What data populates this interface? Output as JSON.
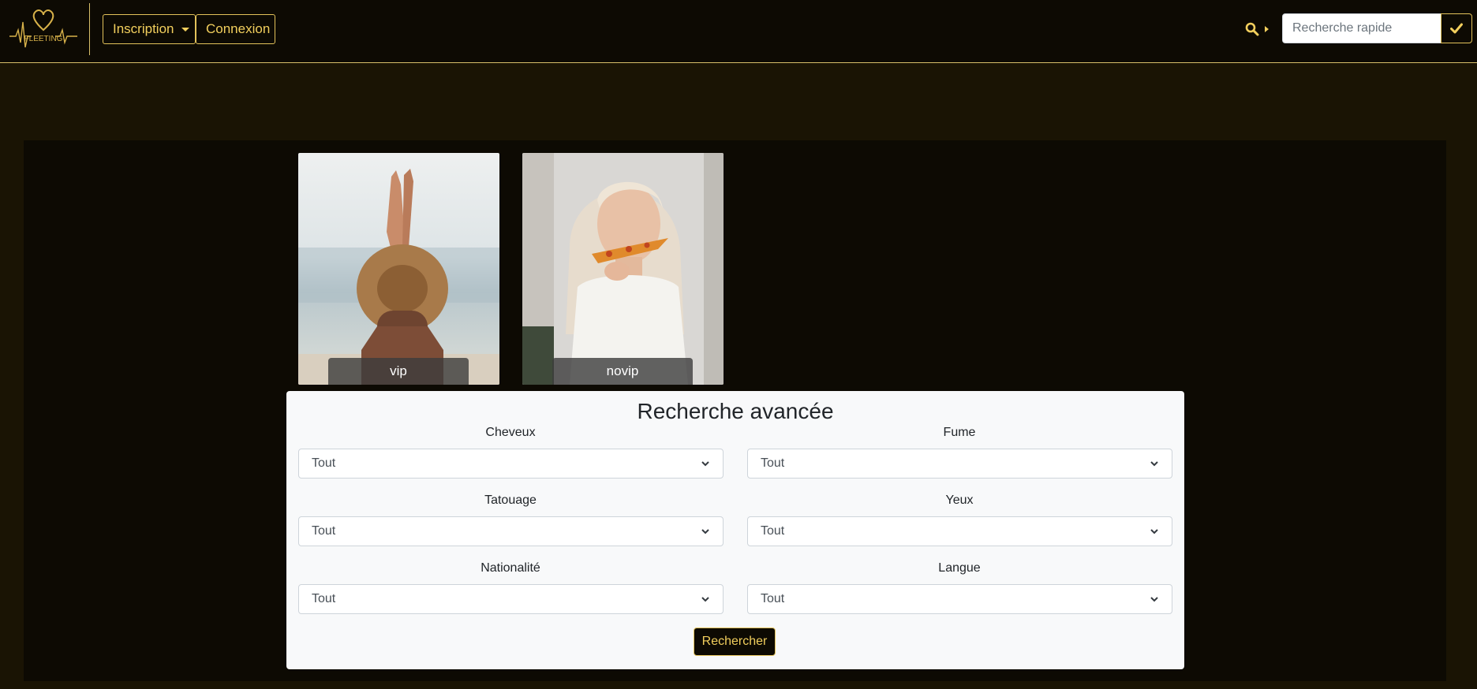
{
  "brand": {
    "logo_text": "FLEETING"
  },
  "navbar": {
    "inscription_label": "Inscription",
    "connexion_label": "Connexion",
    "search_placeholder": "Recherche rapide"
  },
  "cards": [
    {
      "label": "vip"
    },
    {
      "label": "novip"
    }
  ],
  "advanced_search": {
    "title": "Recherche avancée",
    "fields": {
      "cheveux": {
        "label": "Cheveux",
        "value": "Tout"
      },
      "fume": {
        "label": "Fume",
        "value": "Tout"
      },
      "tatouage": {
        "label": "Tatouage",
        "value": "Tout"
      },
      "yeux": {
        "label": "Yeux",
        "value": "Tout"
      },
      "nationalite": {
        "label": "Nationalité",
        "value": "Tout"
      },
      "langue": {
        "label": "Langue",
        "value": "Tout"
      }
    },
    "submit_label": "Rechercher"
  },
  "colors": {
    "accent": "#f2cf5d",
    "navbar_bg": "#0d0a03",
    "page_bg": "#1a1404"
  }
}
